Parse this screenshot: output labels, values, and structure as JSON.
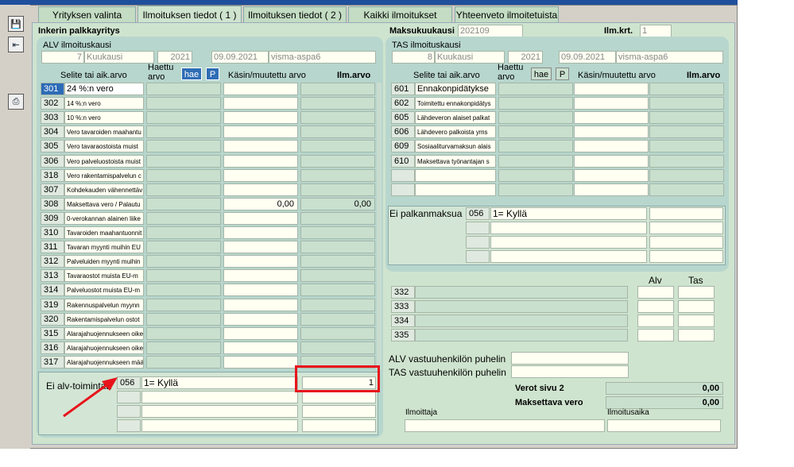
{
  "tabs": [
    "Yrityksen valinta",
    "Ilmoituksen tiedot ( 1 )",
    "Ilmoituksen tiedot ( 2 )",
    "Kaikki ilmoitukset",
    "Yhteenveto ilmoitetuista"
  ],
  "company": "Inkerin palkkayritys",
  "header": {
    "maksukuukausi_label": "Maksukuukausi",
    "maksukuukausi": "202109",
    "ilmkrt_label": "Ilm.krt.",
    "ilmkrt": "1"
  },
  "alv": {
    "title": "ALV ilmoituskausi",
    "num": "7",
    "unit": "Kuukausi",
    "year": "2021",
    "date": "09.09.2021",
    "source": "visma-aspa6"
  },
  "tas": {
    "title": "TAS ilmoituskausi",
    "num": "8",
    "unit": "Kuukausi",
    "year": "2021",
    "date": "09.09.2021",
    "source": "visma-aspa6"
  },
  "col": {
    "selite": "Selite tai aik.arvo",
    "haettu": "Haettu arvo",
    "hae": "hae",
    "p": "P",
    "kasin": "Käsin/muutettu arvo",
    "ilm": "Ilm.arvo"
  },
  "alv_rows": [
    {
      "code": "301",
      "desc": "24 %:n vero",
      "big": true,
      "sel": true
    },
    {
      "code": "302",
      "desc": "14 %:n vero"
    },
    {
      "code": "303",
      "desc": "10 %:n vero"
    },
    {
      "code": "304",
      "desc": "Vero tavaroiden maahantu"
    },
    {
      "code": "305",
      "desc": "Vero tavaraostoista muist"
    },
    {
      "code": "306",
      "desc": "Vero palveluostoista muist"
    },
    {
      "code": "318",
      "desc": "Vero rakentamispalvelun c"
    },
    {
      "code": "307",
      "desc": "Kohdekauden vähennettäv"
    },
    {
      "code": "308",
      "desc": "Maksettava vero / Palautu",
      "kasin": "0,00",
      "ilm": "0,00"
    },
    {
      "code": "309",
      "desc": "0-verokannan alainen liike"
    },
    {
      "code": "310",
      "desc": "Tavaroiden maahantuonnit"
    },
    {
      "code": "311",
      "desc": "Tavaran myynti muihin EU"
    },
    {
      "code": "312",
      "desc": "Palveluiden myynti muihin"
    },
    {
      "code": "313",
      "desc": "Tavaraostot muista EU-m"
    },
    {
      "code": "314",
      "desc": "Palveluostot muista EU-m"
    },
    {
      "code": "319",
      "desc": "Rakennuspalvelun myynn"
    },
    {
      "code": "320",
      "desc": "Rakentamispalvelun ostot"
    },
    {
      "code": "315",
      "desc": "Alarajahuojennukseen oike"
    },
    {
      "code": "316",
      "desc": "Alarajahuojennukseen oike"
    },
    {
      "code": "317",
      "desc": "Alarajahuojennukseen määr"
    }
  ],
  "ei_alv": {
    "label": "Ei alv-toimintaa",
    "code": "056",
    "value": "1= Kyllä",
    "ilm": "1"
  },
  "tas_rows": [
    {
      "code": "601",
      "desc": "Ennakonpidätykse",
      "big": true
    },
    {
      "code": "602",
      "desc": "Toimitettu ennakonpidätys"
    },
    {
      "code": "605",
      "desc": "Lähdeveron alaiset palkat"
    },
    {
      "code": "606",
      "desc": "Lähdevero palkoista yms"
    },
    {
      "code": "609",
      "desc": "Sosiaaliturvamaksun alais"
    },
    {
      "code": "610",
      "desc": "Maksettava työnantajan s"
    }
  ],
  "ei_palkan": {
    "label": "Ei palkanmaksua",
    "code": "056",
    "value": "1= Kyllä"
  },
  "alvtas": {
    "alv": "Alv",
    "tas": "Tas",
    "codes": [
      "332",
      "333",
      "334",
      "335"
    ]
  },
  "contact": {
    "alv_phone": "ALV vastuuhenkilön puhelin",
    "tas_phone": "TAS vastuuhenkilön puhelin"
  },
  "totals": {
    "verot_label": "Verot sivu 2",
    "verot": "0,00",
    "maksettava_label": "Maksettava vero",
    "maksettava": "0,00"
  },
  "footer": {
    "ilmoittaja": "Ilmoittaja",
    "ilmoitusaika": "Ilmoitusaika"
  },
  "colors": {
    "highlight": "#e8141c",
    "arrow": "#e8141c",
    "selected": "#2d6bb7"
  }
}
